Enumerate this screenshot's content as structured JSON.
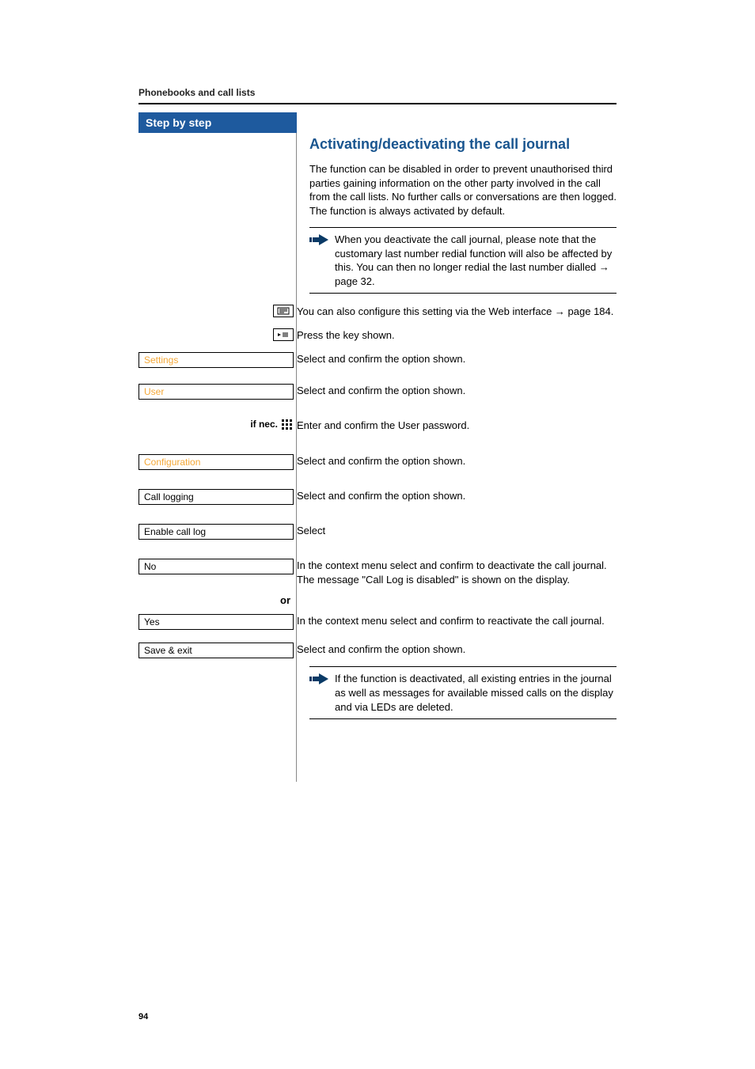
{
  "running_head": "Phonebooks and call lists",
  "sidebar": {
    "header": "Step by step",
    "items": [
      {
        "label": "Settings",
        "highlight": true
      },
      {
        "label": "User",
        "highlight": true
      },
      {
        "label": "Configuration",
        "highlight": true
      },
      {
        "label": "Call logging",
        "highlight": false
      },
      {
        "label": "Enable call log",
        "highlight": false
      },
      {
        "label": "No",
        "highlight": false
      },
      {
        "label": "Yes",
        "highlight": false
      },
      {
        "label": "Save & exit",
        "highlight": false
      }
    ],
    "ifnec": "if nec.",
    "or_label": "or"
  },
  "section": {
    "title": "Activating/deactivating the call journal",
    "intro": "The function can be disabled in order to prevent unauthorised third parties gaining information on the other party involved in the call from the call lists. No further calls or conversations are then logged. The function is always activated by default.",
    "note1": "When you deactivate the call journal, please note that the customary last number redial function will also be affected by this. You can then no longer redial the last number dialled → page 32.",
    "webinfo": "You can also configure this setting via the Web interface → page 184.",
    "steps": {
      "press_key": "Press the key shown.",
      "settings": "Select and confirm the option shown.",
      "user": "Select and confirm the option shown.",
      "password": "Enter and confirm the User password.",
      "configuration": "Select and confirm the option shown.",
      "call_logging": "Select and confirm the option shown.",
      "enable_call_log": "Select",
      "no": "In the context menu select and confirm to deactivate the call journal. The message \"Call Log is disabled\" is shown on the display.",
      "yes": "In the context menu select and confirm to reactivate the call journal.",
      "save_exit": "Select and confirm the option shown."
    },
    "note2": "If the function is deactivated, all existing entries in the journal as well as messages for available missed calls on the display and via LEDs are deleted."
  },
  "page_number": "94"
}
